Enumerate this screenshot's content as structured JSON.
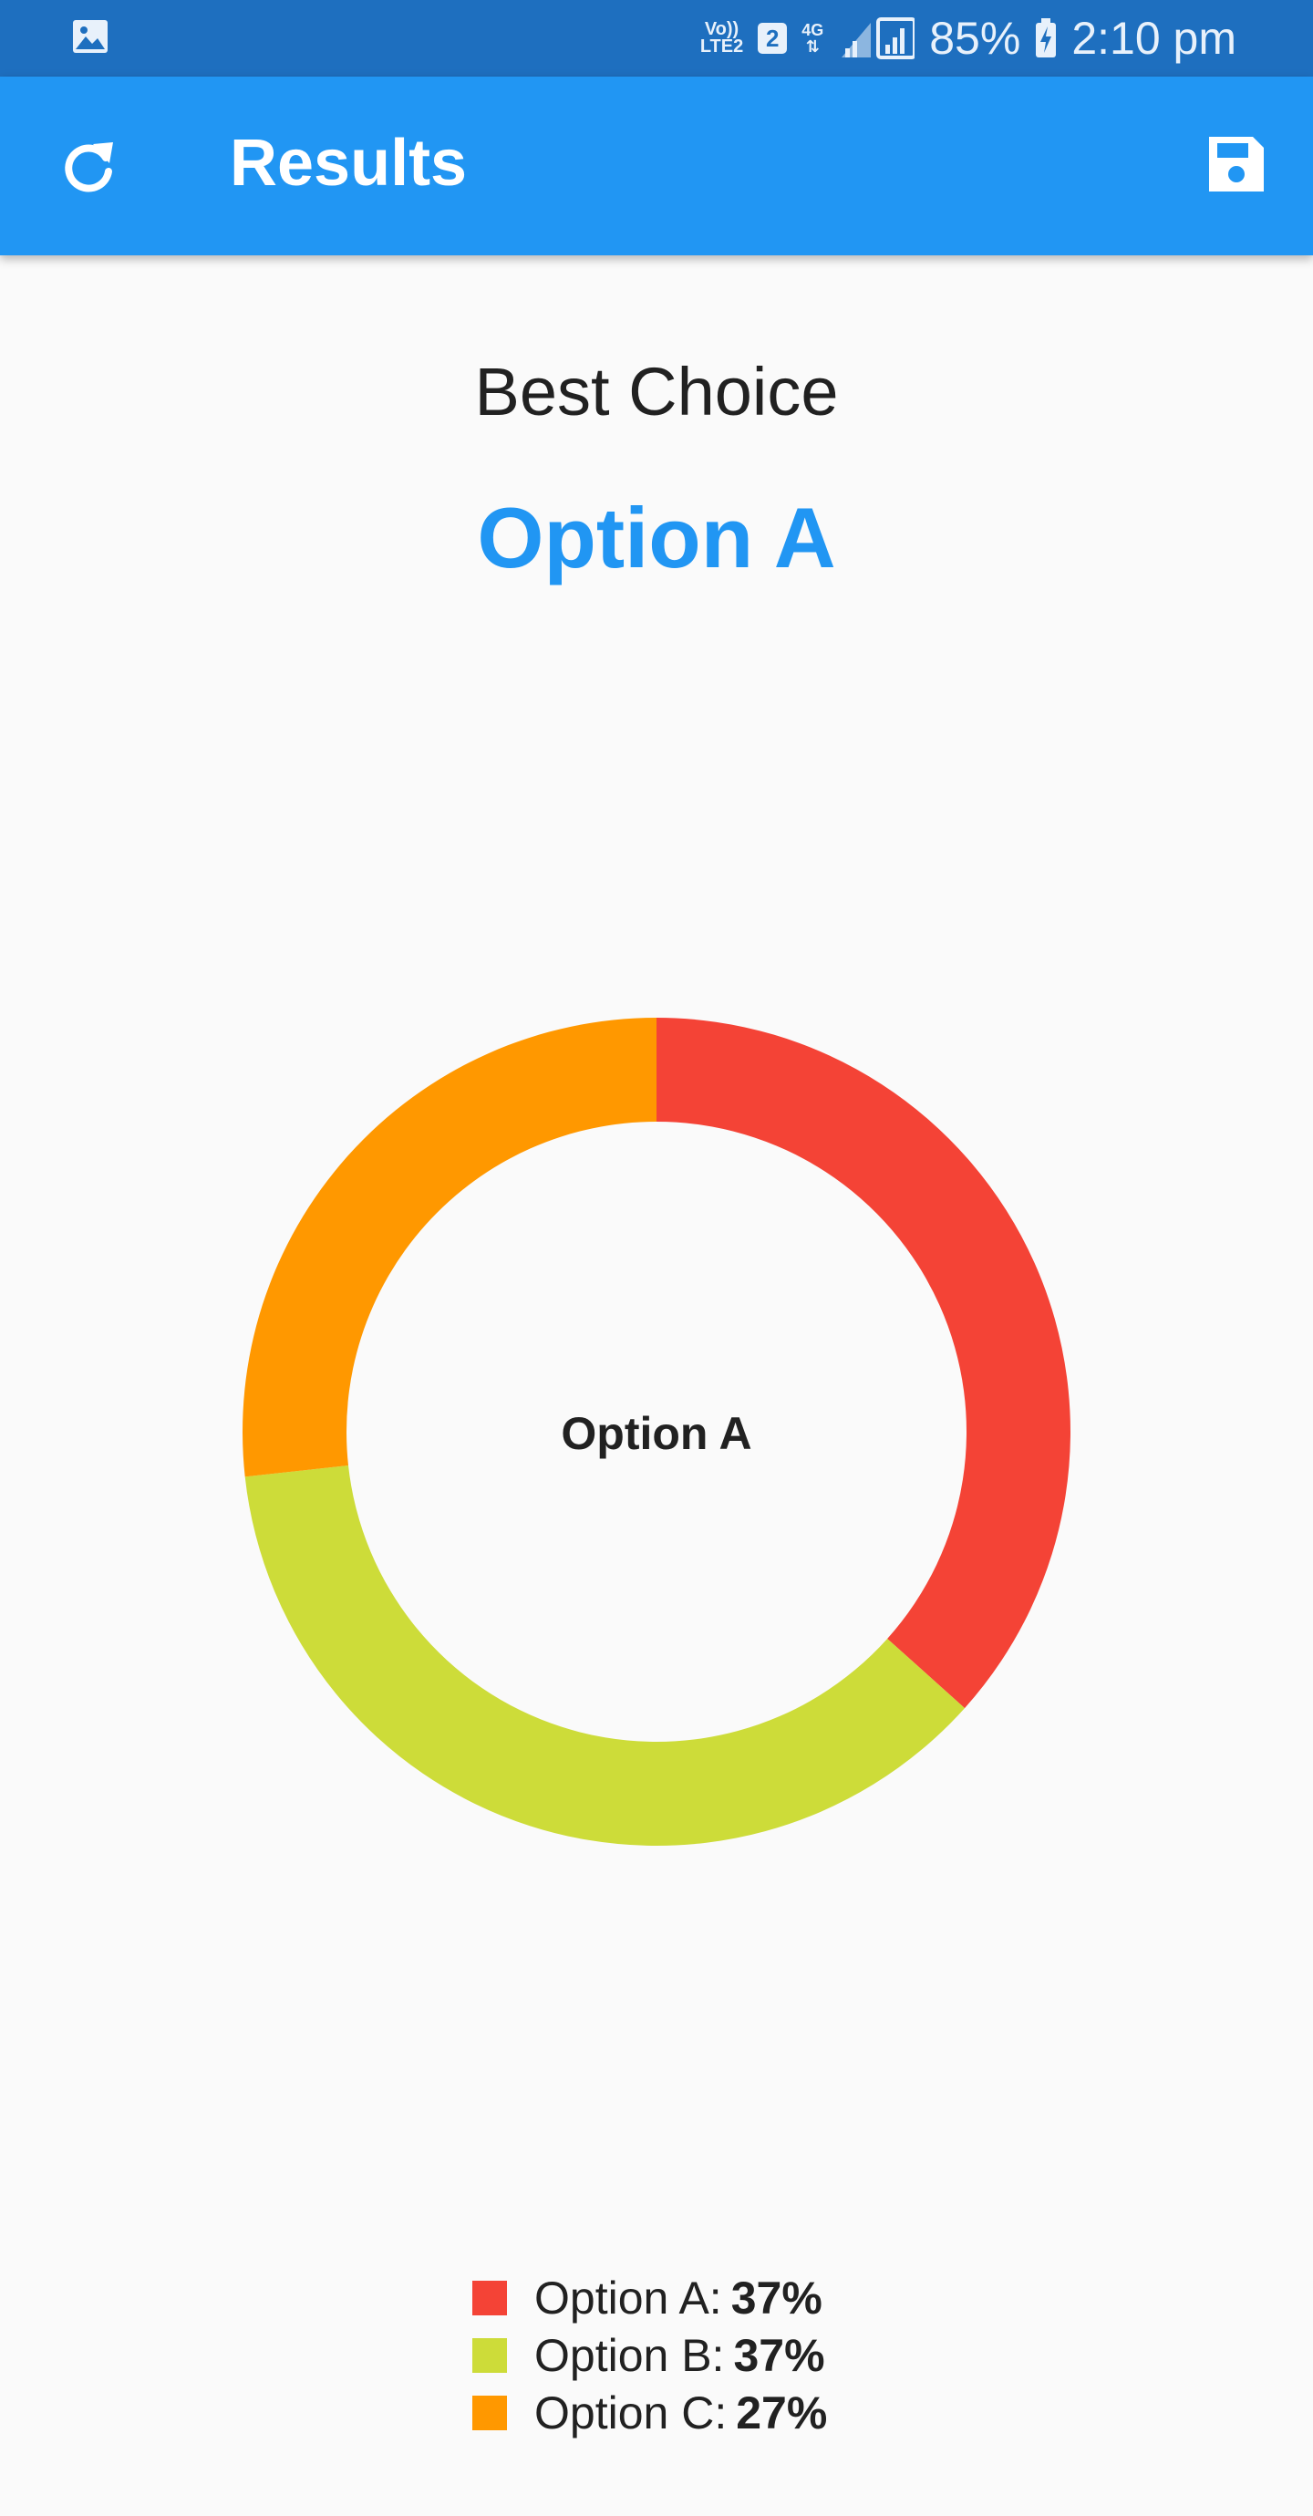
{
  "status_bar": {
    "volte_top": "Vo))",
    "volte_bottom": "LTE2",
    "sim": "2",
    "network": "4G",
    "battery": "85%",
    "time": "2:10 pm",
    "icons": [
      "gallery-icon",
      "signal-icon",
      "battery-icon"
    ]
  },
  "app_bar": {
    "title": "Results",
    "left_icon": "refresh-icon",
    "right_icon": "save-icon",
    "color": "#2196f3"
  },
  "result": {
    "subtitle": "Best Choice",
    "winner": "Option A"
  },
  "chart_data": {
    "type": "pie",
    "variant": "donut",
    "center_label": "Option A",
    "start_angle": "12 o'clock, clockwise",
    "slices": [
      {
        "label": "Option A",
        "value": 37,
        "color": "#f44336"
      },
      {
        "label": "Option B",
        "value": 37,
        "color": "#cddc39"
      },
      {
        "label": "Option C",
        "value": 27,
        "color": "#ff9800"
      }
    ]
  },
  "legend": [
    {
      "label": "Option A:",
      "value": "37%"
    },
    {
      "label": "Option B:",
      "value": "37%"
    },
    {
      "label": "Option C:",
      "value": "27%"
    }
  ]
}
